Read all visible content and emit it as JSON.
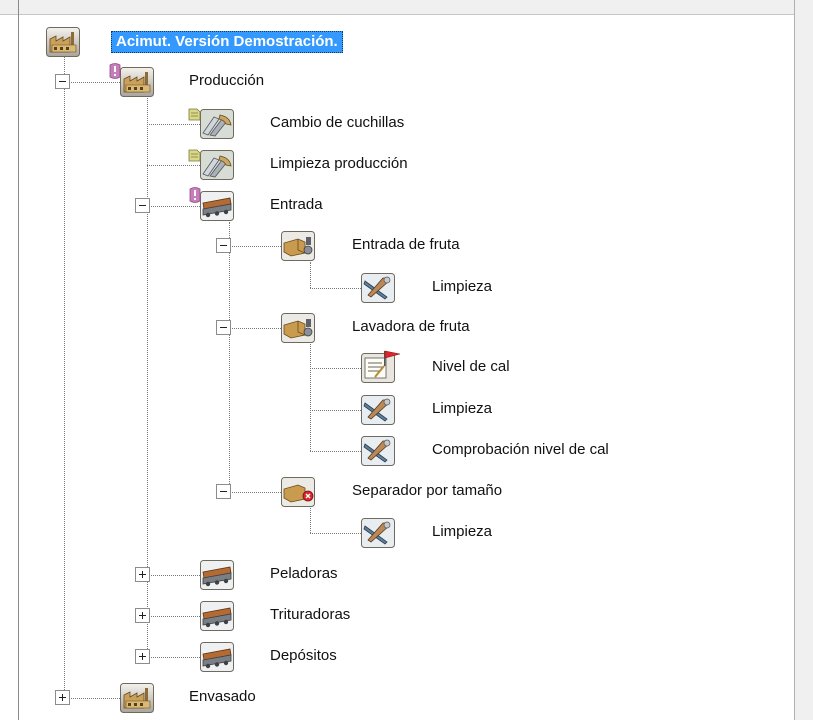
{
  "tree": {
    "root": {
      "label": "Acimut. Versión Demostración.",
      "icon": "factory-icon",
      "selected": true,
      "expanded": true
    },
    "nodes": [
      {
        "label": "Producción",
        "icon": "factory-icon",
        "badge": "alert-badge",
        "expanded": true
      },
      {
        "label": "Cambio de cuchillas",
        "icon": "tools-icon",
        "badge": "tag-badge"
      },
      {
        "label": "Limpieza producción",
        "icon": "tools-icon",
        "badge": "tag-badge"
      },
      {
        "label": "Entrada",
        "icon": "conveyor-icon",
        "badge": "alert-badge",
        "expanded": true
      },
      {
        "label": "Entrada de fruta",
        "icon": "machine-icon",
        "expanded": true
      },
      {
        "label": "Limpieza",
        "icon": "wrench-icon"
      },
      {
        "label": "Lavadora de fruta",
        "icon": "machine-icon",
        "expanded": true
      },
      {
        "label": "Nivel de cal",
        "icon": "checklist-flag-icon"
      },
      {
        "label": "Limpieza",
        "icon": "wrench-icon"
      },
      {
        "label": "Comprobación nivel de cal",
        "icon": "wrench-icon"
      },
      {
        "label": "Separador por tamaño",
        "icon": "machine-alert-icon",
        "expanded": true
      },
      {
        "label": "Limpieza",
        "icon": "wrench-icon"
      },
      {
        "label": "Peladoras",
        "icon": "conveyor-icon",
        "expanded": false
      },
      {
        "label": "Trituradoras",
        "icon": "conveyor-icon",
        "expanded": false
      },
      {
        "label": "Depósitos",
        "icon": "conveyor-icon",
        "expanded": false
      },
      {
        "label": "Envasado",
        "icon": "factory-icon",
        "expanded": false
      }
    ]
  },
  "colors": {
    "selection": "#3399ff",
    "tree_lines": "#7a7a7a",
    "badge_alert": "#c77dbb",
    "badge_tag": "#d8d88a"
  }
}
